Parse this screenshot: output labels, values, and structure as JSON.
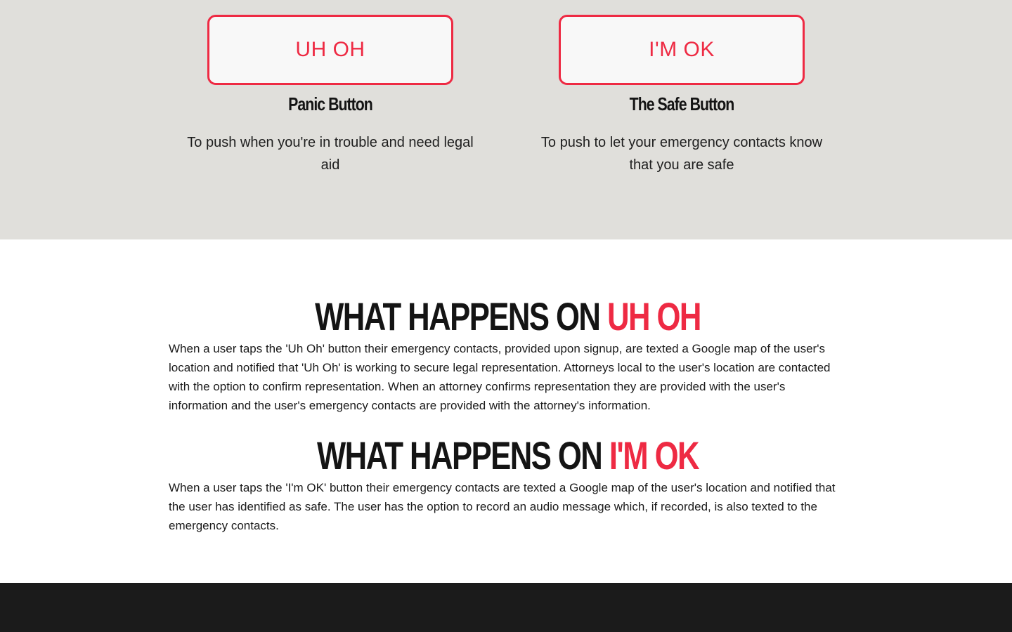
{
  "buttons": {
    "panic": {
      "label": "UH OH",
      "title": "Panic Button",
      "description": "To push when you're in trouble and need legal aid"
    },
    "safe": {
      "label": "I'M OK",
      "title": "The Safe Button",
      "description": "To push to let your emergency contacts know that you are safe"
    }
  },
  "info": {
    "uh_oh": {
      "heading_prefix": "WHAT HAPPENS ON ",
      "heading_accent": "UH OH",
      "body": "When a user taps the 'Uh Oh' button their emergency contacts, provided upon signup, are texted a Google map of the user's location and notified that 'Uh Oh' is working to secure legal representation. Attorneys local to the user's location are contacted with the option to confirm representation. When an attorney confirms representation they are provided with the user's information and the user's emergency contacts are provided with the attorney's information."
    },
    "im_ok": {
      "heading_prefix": "WHAT HAPPENS ON ",
      "heading_accent": "I'M OK",
      "body": "When a user taps the 'I'm OK' button their emergency contacts are texted a Google map of the user's location and notified that the user has identified as safe. The user has the option to record an audio message which, if recorded, is also texted to the emergency contacts."
    }
  },
  "colors": {
    "accent": "#ee2a43",
    "top_background": "#e0dfdb",
    "footer_background": "#1b1b1b"
  }
}
